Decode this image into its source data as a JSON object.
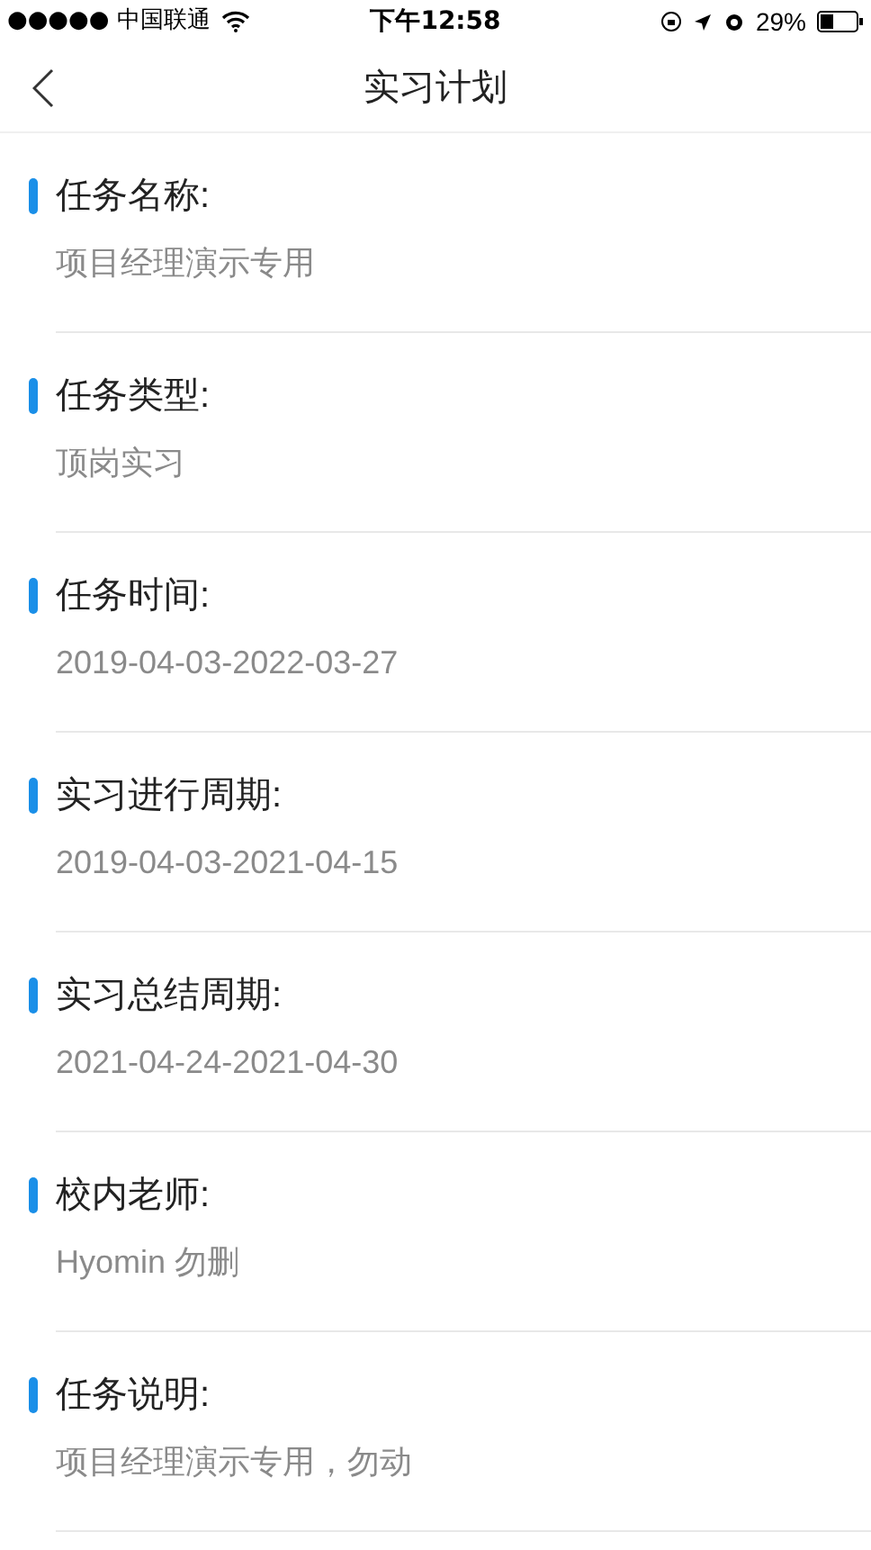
{
  "status_bar": {
    "carrier": "●●●●● 中国联通",
    "time": "下午12:58",
    "battery": "29%"
  },
  "nav": {
    "title": "实习计划"
  },
  "fields": [
    {
      "label": "任务名称:",
      "value": "项目经理演示专用"
    },
    {
      "label": "任务类型:",
      "value": "顶岗实习"
    },
    {
      "label": "任务时间:",
      "value": "2019-04-03-2022-03-27"
    },
    {
      "label": "实习进行周期:",
      "value": "2019-04-03-2021-04-15"
    },
    {
      "label": "实习总结周期:",
      "value": "2021-04-24-2021-04-30"
    },
    {
      "label": "校内老师:",
      "value": "Hyomin 勿删"
    },
    {
      "label": "任务说明:",
      "value": "项目经理演示专用，勿动"
    }
  ]
}
